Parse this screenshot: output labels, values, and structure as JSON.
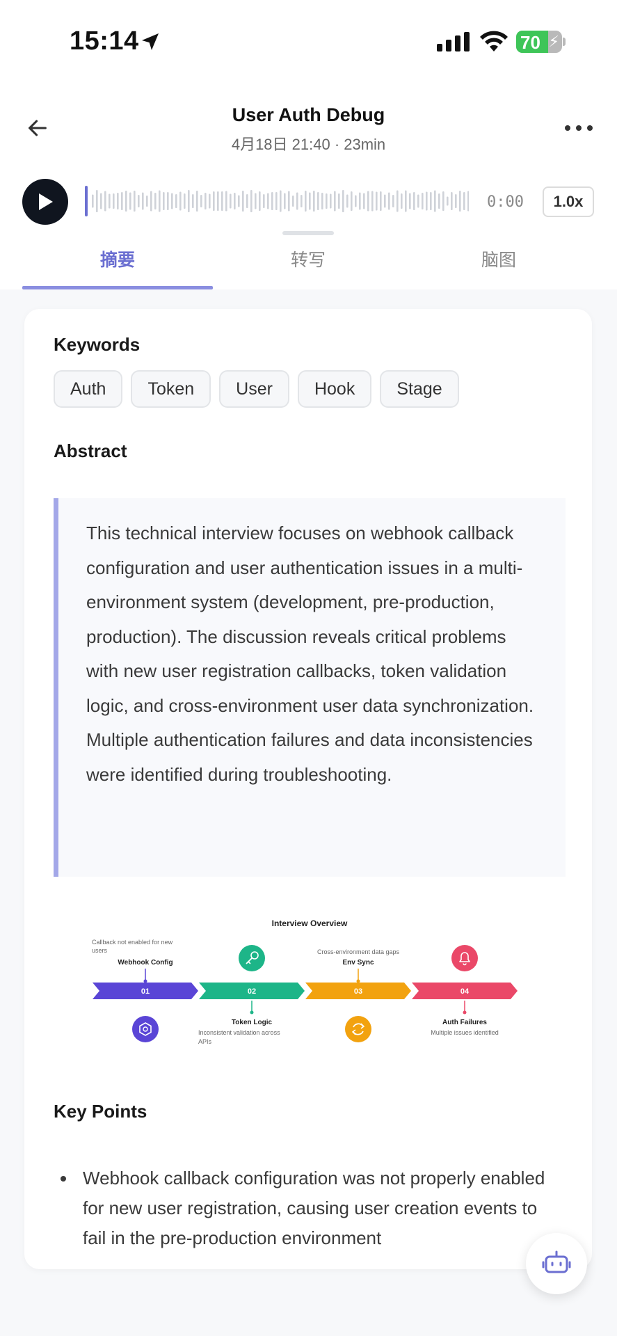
{
  "status_bar": {
    "time": "15:14",
    "battery_percent": "70",
    "battery_level": 0.7,
    "icons": [
      "location-arrow-icon",
      "cellular-signal-icon",
      "wifi-icon",
      "battery-charging-icon"
    ]
  },
  "header": {
    "title": "User Auth Debug",
    "subtitle": "4月18日 21:40 · 23min",
    "back_icon": "arrow-left-icon",
    "more_icon": "ellipsis-horizontal-icon"
  },
  "player": {
    "play_icon": "play-icon",
    "time": "0:00",
    "speed": "1.0x",
    "progress": 0
  },
  "tabs": [
    {
      "label": "摘要",
      "active": true
    },
    {
      "label": "转写",
      "active": false
    },
    {
      "label": "脑图",
      "active": false
    }
  ],
  "keywords": {
    "heading": "Keywords",
    "items": [
      "Auth",
      "Token",
      "User",
      "Hook",
      "Stage"
    ]
  },
  "abstract": {
    "heading": "Abstract",
    "text": "This technical interview focuses on webhook callback configuration and user authentication issues in a multi-environment system (development, pre-production, production). The discussion reveals critical problems with new user registration callbacks, token validation logic, and cross-environment user data synchronization. Multiple authentication failures and data inconsistencies were identified during troubleshooting."
  },
  "overview": {
    "title": "Interview Overview",
    "steps": [
      {
        "num": "01",
        "label": "Webhook Config",
        "note": "Callback not enabled for new users",
        "icon": "hexagon-icon",
        "color": "#5a45d6"
      },
      {
        "num": "02",
        "label": "Token Logic",
        "note": "Inconsistent validation across APIs",
        "icon": "key-icon",
        "color": "#1db588"
      },
      {
        "num": "03",
        "label": "Env Sync",
        "note": "Cross-environment data gaps",
        "icon": "sync-icon",
        "color": "#f2a20f"
      },
      {
        "num": "04",
        "label": "Auth Failures",
        "note": "Multiple issues identified",
        "icon": "bell-icon",
        "color": "#ea4868"
      }
    ]
  },
  "key_points": {
    "heading": "Key Points",
    "items": [
      "Webhook callback configuration was not properly enabled for new user registration, causing user creation events to fail in the pre-production environment"
    ]
  },
  "fab": {
    "icon": "robot-icon"
  }
}
